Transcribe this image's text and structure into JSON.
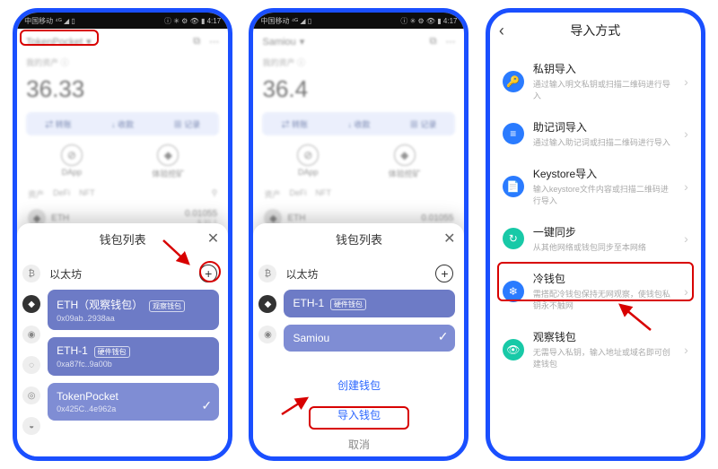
{
  "statusbar": {
    "left": "中国移动 ⁴ᴳ ◢ ▯",
    "right": "ⓘ ✳ ⚙ 👁 ▮ 4:17"
  },
  "screen1": {
    "walletName": "TokenPocket",
    "balanceLabel": "我的资产 ⓘ",
    "balance": "36.33",
    "tabs": [
      "⇄ 转账",
      "↓ 收款",
      "▦ 记录"
    ],
    "iconRow": [
      {
        "icon": "⊘",
        "label": "DApp"
      },
      {
        "icon": "◆",
        "label": "体验挖矿"
      }
    ],
    "tinyTabs": [
      "资产",
      "DeFi",
      "NFT"
    ],
    "asset": {
      "sym": "ETH",
      "val": "0.01055",
      "sub": "$ 31.1"
    },
    "sheetTitle": "钱包列表",
    "chainName": "以太坊",
    "wallets": [
      {
        "name": "ETH（观察钱包）",
        "badge": "观察钱包",
        "addr": "0x09ab..2938aa"
      },
      {
        "name": "ETH-1",
        "badge": "硬件钱包",
        "addr": "0xa87fc..9a00b"
      },
      {
        "name": "TokenPocket",
        "addr": "0x425C..4e962a",
        "check": true
      }
    ]
  },
  "screen2": {
    "walletName": "Samiou",
    "balance": "36.4",
    "sheetTitle": "钱包列表",
    "chainName": "以太坊",
    "wallets": [
      {
        "name": "ETH-1",
        "badge": "硬件钱包"
      },
      {
        "name": "Samiou",
        "check": true
      }
    ],
    "btnCreate": "创建钱包",
    "btnImport": "导入钱包",
    "btnCancel": "取消"
  },
  "screen3": {
    "title": "导入方式",
    "options": [
      {
        "color": "#2a7bff",
        "icon": "🔑",
        "title": "私钥导入",
        "sub": "通过输入明文私钥或扫描二维码进行导入"
      },
      {
        "color": "#2a7bff",
        "icon": "≡",
        "title": "助记词导入",
        "sub": "通过输入助记词或扫描二维码进行导入"
      },
      {
        "color": "#2a7bff",
        "icon": "📄",
        "title": "Keystore导入",
        "sub": "输入keystore文件内容或扫描二维码进行导入"
      },
      {
        "color": "#18c9a7",
        "icon": "↻",
        "title": "一键同步",
        "sub": "从其他网络或钱包同步至本网络"
      },
      {
        "color": "#2a7bff",
        "icon": "❄",
        "title": "冷钱包",
        "sub": "需搭配冷钱包保持无网观察，使钱包私钥永不触网"
      },
      {
        "color": "#18c9a7",
        "icon": "👁",
        "title": "观察钱包",
        "sub": "无需导入私钥，输入地址或域名即可创建钱包"
      }
    ]
  }
}
